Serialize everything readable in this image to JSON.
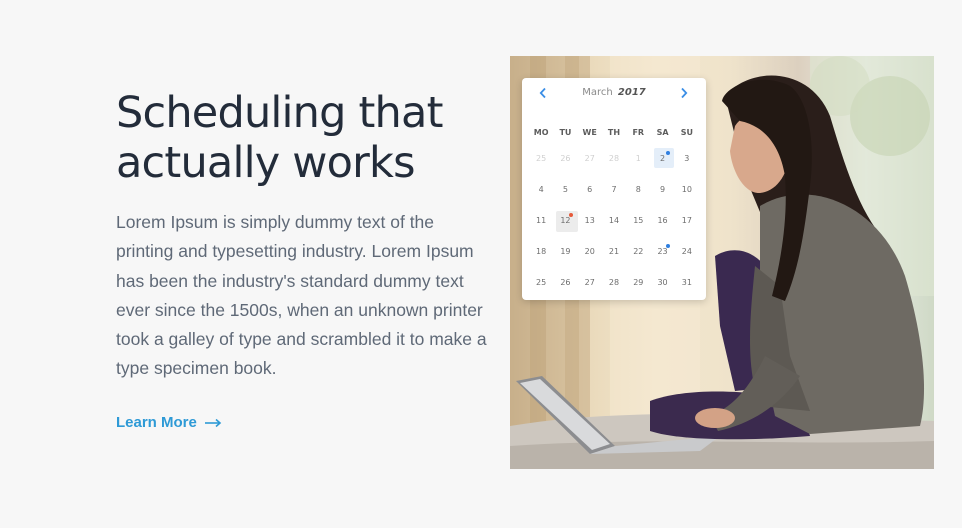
{
  "hero": {
    "title": "Scheduling that actually works",
    "body": "Lorem Ipsum is simply dummy text of the printing and typesetting industry. Lorem Ipsum has been the industry's standard dummy text ever since the 1500s, when an unknown printer took a galley of type and scrambled it to make a type specimen book.",
    "cta_label": "Learn More",
    "cta_icon": "arrow-right-icon",
    "colors": {
      "title": "#232c3a",
      "body": "#5f6977",
      "cta": "#2e9ad6",
      "background": "#f7f7f7"
    }
  },
  "calendar": {
    "month": "March",
    "year": "2017",
    "prev_icon": "chevron-left-icon",
    "next_icon": "chevron-right-icon",
    "weekdays": [
      "MO",
      "TU",
      "WE",
      "TH",
      "FR",
      "SA",
      "SU"
    ],
    "days": [
      {
        "label": "25",
        "muted": true
      },
      {
        "label": "26",
        "muted": true
      },
      {
        "label": "27",
        "muted": true
      },
      {
        "label": "28",
        "muted": true
      },
      {
        "label": "1",
        "muted": true
      },
      {
        "label": "2",
        "selected": true,
        "event": "blue"
      },
      {
        "label": "3"
      },
      {
        "label": "4"
      },
      {
        "label": "5"
      },
      {
        "label": "6"
      },
      {
        "label": "7"
      },
      {
        "label": "8"
      },
      {
        "label": "9"
      },
      {
        "label": "10"
      },
      {
        "label": "11"
      },
      {
        "label": "12",
        "today": true,
        "event": "red"
      },
      {
        "label": "13"
      },
      {
        "label": "14"
      },
      {
        "label": "15"
      },
      {
        "label": "16"
      },
      {
        "label": "17"
      },
      {
        "label": "18"
      },
      {
        "label": "19"
      },
      {
        "label": "20"
      },
      {
        "label": "21"
      },
      {
        "label": "22"
      },
      {
        "label": "23",
        "event": "blue"
      },
      {
        "label": "24"
      },
      {
        "label": "25"
      },
      {
        "label": "26"
      },
      {
        "label": "27"
      },
      {
        "label": "28"
      },
      {
        "label": "29"
      },
      {
        "label": "30"
      },
      {
        "label": "31"
      }
    ],
    "colors": {
      "accent": "#3a8ee6",
      "event_blue": "#2f7fe0",
      "event_red": "#e65a3a",
      "selected_bg": "#e4eef9",
      "today_bg": "#ececec"
    }
  },
  "photo": {
    "subject": "woman-using-laptop-photo"
  }
}
